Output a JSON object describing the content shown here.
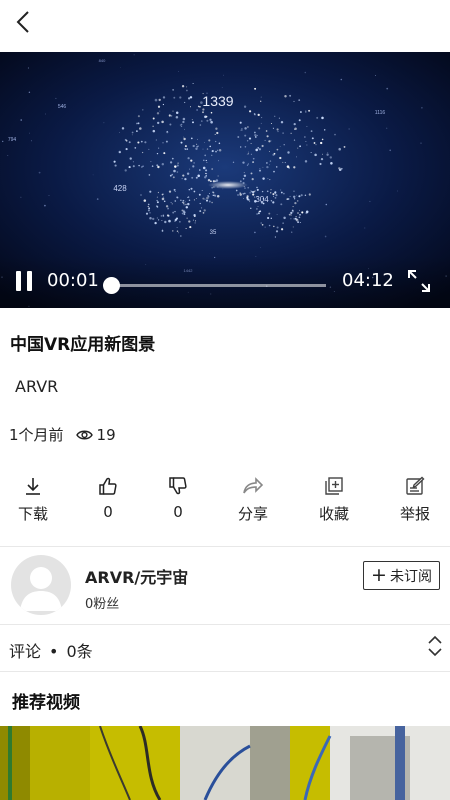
{
  "header": {
    "back_icon": "chevron-left-icon"
  },
  "player": {
    "current_time": "00:01",
    "total_time": "04:12",
    "progress": 0.004,
    "overlay_numbers": {
      "big": "1339",
      "left": "428",
      "right": "304",
      "bottom": "35",
      "top_right": "1116",
      "small_left": "546",
      "far_left": "794",
      "top_mid": "840",
      "bottom_mid": "1442"
    },
    "icons": {
      "pause": "pause-icon",
      "fullscreen": "fullscreen-icon"
    }
  },
  "video": {
    "title": "中国VR应用新图景",
    "tag": "ARVR",
    "posted": "1个月前",
    "views": "19"
  },
  "actions": [
    {
      "icon": "download-icon",
      "label": "下载"
    },
    {
      "icon": "thumbs-up-icon",
      "label": "0"
    },
    {
      "icon": "thumbs-down-icon",
      "label": "0"
    },
    {
      "icon": "share-icon",
      "label": "分享"
    },
    {
      "icon": "collect-icon",
      "label": "收藏"
    },
    {
      "icon": "report-icon",
      "label": "举报"
    }
  ],
  "author": {
    "name": "ARVR/元宇宙",
    "fans": "0粉丝",
    "subscribe_label": "未订阅"
  },
  "comments": {
    "label": "评论",
    "separator": "•",
    "count": "0条"
  },
  "recommend": {
    "title": "推荐视频"
  },
  "colors": {
    "player_bg": "#050b1e",
    "accent_text": "#222222",
    "thumb_yellow": "#c9c000"
  }
}
